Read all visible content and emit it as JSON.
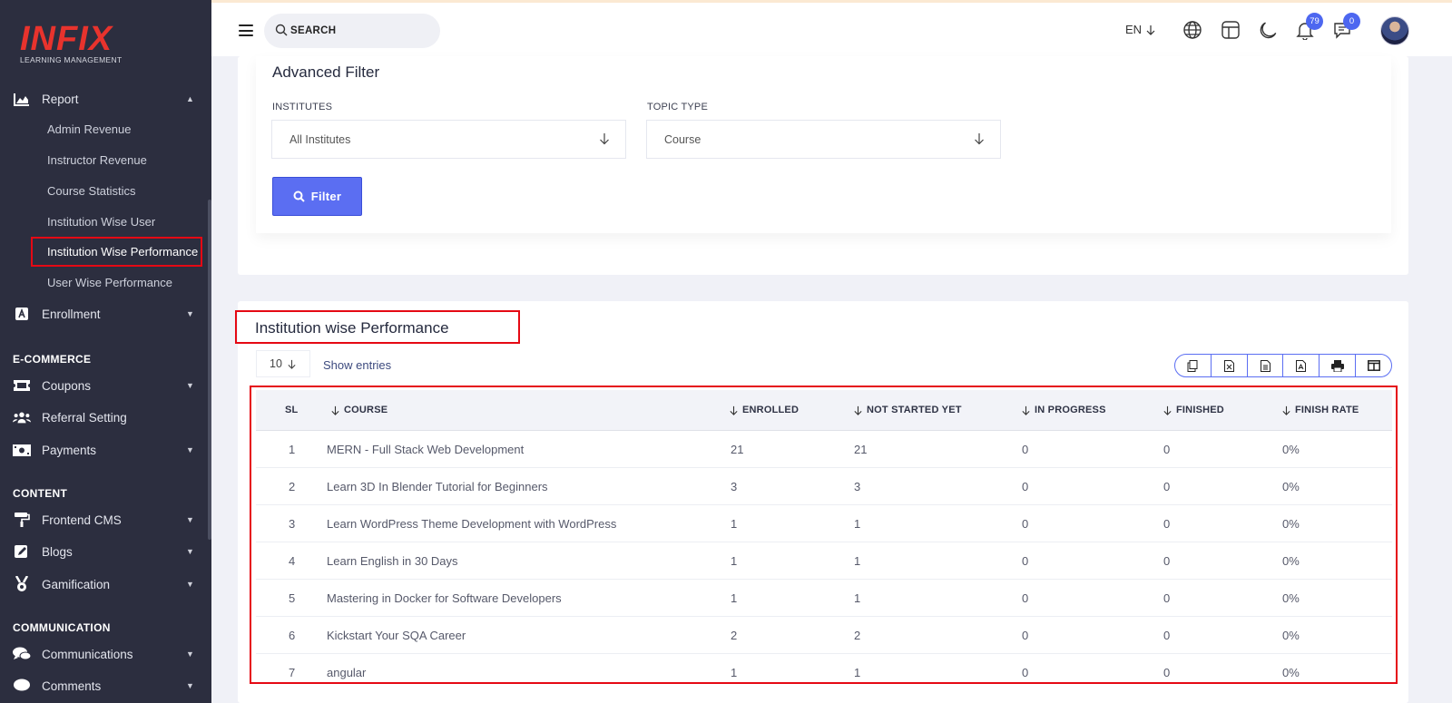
{
  "brand": {
    "logo": "INFIX",
    "subtitle": "LEARNING MANAGEMENT"
  },
  "sidebar": {
    "report": {
      "label": "Report"
    },
    "report_items": [
      "Admin Revenue",
      "Instructor Revenue",
      "Course Statistics",
      "Institution Wise User",
      "Institution Wise Performance",
      "User Wise Performance"
    ],
    "enrollment": {
      "label": "Enrollment"
    },
    "sections": {
      "ecommerce": "E-COMMERCE",
      "content": "CONTENT",
      "communication": "COMMUNICATION"
    },
    "coupons": {
      "label": "Coupons"
    },
    "referral": {
      "label": "Referral Setting"
    },
    "payments": {
      "label": "Payments"
    },
    "frontend_cms": {
      "label": "Frontend CMS"
    },
    "blogs": {
      "label": "Blogs"
    },
    "gamification": {
      "label": "Gamification"
    },
    "communications": {
      "label": "Communications"
    },
    "comments": {
      "label": "Comments"
    }
  },
  "topbar": {
    "search_placeholder": "SEARCH",
    "language": "EN",
    "notifications_count": "79",
    "messages_count": "0"
  },
  "filter": {
    "title": "Advanced Filter",
    "institutes_label": "INSTITUTES",
    "institutes_value": "All Institutes",
    "topic_type_label": "TOPIC TYPE",
    "topic_type_value": "Course",
    "button_label": "Filter"
  },
  "table_card": {
    "title": "Institution wise Performance",
    "entries_value": "10",
    "show_entries_label": "Show entries",
    "headers": {
      "sl": "SL",
      "course": "COURSE",
      "enrolled": "ENROLLED",
      "not_started": "NOT STARTED YET",
      "in_progress": "IN PROGRESS",
      "finished": "FINISHED",
      "finish_rate": "FINISH RATE"
    },
    "rows": [
      {
        "sl": "1",
        "course": "MERN - Full Stack Web Development",
        "enrolled": "21",
        "not_started": "21",
        "in_progress": "0",
        "finished": "0",
        "finish_rate": "0%"
      },
      {
        "sl": "2",
        "course": "Learn 3D In Blender Tutorial for Beginners",
        "enrolled": "3",
        "not_started": "3",
        "in_progress": "0",
        "finished": "0",
        "finish_rate": "0%"
      },
      {
        "sl": "3",
        "course": "Learn WordPress Theme Development with WordPress",
        "enrolled": "1",
        "not_started": "1",
        "in_progress": "0",
        "finished": "0",
        "finish_rate": "0%"
      },
      {
        "sl": "4",
        "course": "Learn English in 30 Days",
        "enrolled": "1",
        "not_started": "1",
        "in_progress": "0",
        "finished": "0",
        "finish_rate": "0%"
      },
      {
        "sl": "5",
        "course": "Mastering in Docker for Software Developers",
        "enrolled": "1",
        "not_started": "1",
        "in_progress": "0",
        "finished": "0",
        "finish_rate": "0%"
      },
      {
        "sl": "6",
        "course": "Kickstart Your SQA Career",
        "enrolled": "2",
        "not_started": "2",
        "in_progress": "0",
        "finished": "0",
        "finish_rate": "0%"
      },
      {
        "sl": "7",
        "course": "angular",
        "enrolled": "1",
        "not_started": "1",
        "in_progress": "0",
        "finished": "0",
        "finish_rate": "0%"
      }
    ]
  },
  "colors": {
    "accent": "#5b6ef2",
    "sidebar": "#2c2e3f",
    "highlight": "#e50914",
    "logo": "#e8332d"
  }
}
